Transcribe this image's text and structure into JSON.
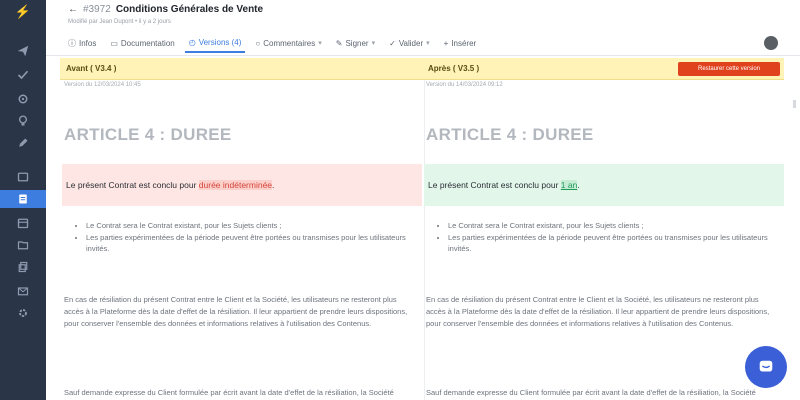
{
  "sidebar": {
    "logo": "⚡",
    "items": [
      {
        "icon": "send-icon"
      },
      {
        "icon": "check-icon"
      },
      {
        "icon": "settings-icon"
      },
      {
        "icon": "lightbulb-icon"
      },
      {
        "icon": "pen-icon"
      },
      {
        "icon": "inbox-icon"
      },
      {
        "icon": "document-icon",
        "active": true
      },
      {
        "icon": "calendar-icon"
      },
      {
        "icon": "folder-icon"
      },
      {
        "icon": "copy-icon"
      },
      {
        "icon": "mail-icon"
      },
      {
        "icon": "gear-icon"
      }
    ],
    "active_color": "#3d7de0"
  },
  "header": {
    "back": "←",
    "doc_id": "#3972",
    "doc_title": "Conditions Générales de Vente",
    "subtitle": "Modifié par Jean Dupont • il y a 2 jours",
    "tabs": [
      {
        "label": "Infos",
        "icon": "info-icon"
      },
      {
        "label": "Documentation",
        "icon": "book-icon"
      },
      {
        "label": "Versions (4)",
        "icon": "history-icon",
        "active": true
      },
      {
        "label": "Commentaires",
        "icon": "comment-icon",
        "chevron": true
      },
      {
        "label": "Signer",
        "icon": "pen-icon",
        "chevron": true
      },
      {
        "label": "Valider",
        "icon": "check-icon",
        "chevron": true
      },
      {
        "label": "Insérer",
        "icon": "plus-icon"
      }
    ]
  },
  "compare": {
    "left_label": "Avant ( V3.4 )",
    "right_label": "Après ( V3.5 )",
    "action_button": "Restaurer cette version",
    "left_meta": "Version du 12/03/2024 10:45",
    "right_meta": "Version du 14/03/2024 09:12",
    "bar_color": "#fff3b8",
    "button_color": "#e0421e"
  },
  "left": {
    "article_title": "ARTICLE 4 : DUREE",
    "diff_prefix": "Le présent Contrat est conclu pour ",
    "diff_changed": "durée indéterminée",
    "diff_suffix": ".",
    "bullets": [
      "Le Contrat sera le Contrat existant, pour les Sujets clients ;",
      "Les parties expérimentées de la période peuvent être portées ou transmises pour les utilisateurs invités."
    ],
    "paragraph1": "En cas de résiliation du présent Contrat entre le Client et la Société, les utilisateurs ne resteront plus accès à la Plateforme dès la date d'effet de la résiliation. Il leur appartient de prendre leurs dispositions, pour conserver l'ensemble des données et informations relatives à l'utilisation des Contenus.",
    "paragraph2": "Sauf demande expresse du Client formulée par écrit avant la date d'effet de la résiliation, la Société pourra supprimer ces données à l'issue de cette période."
  },
  "right": {
    "article_title": "ARTICLE 4 : DUREE",
    "diff_prefix": "Le présent Contrat est conclu pour ",
    "diff_changed": "1 an",
    "diff_suffix": ".",
    "bullets": [
      "Le Contrat sera le Contrat existant, pour les Sujets clients ;",
      "Les parties expérimentées de la période peuvent être portées ou transmises pour les utilisateurs invités."
    ],
    "paragraph1": "En cas de résiliation du présent Contrat entre le Client et la Société, les utilisateurs ne resteront plus accès à la Plateforme dès la date d'effet de la résiliation. Il leur appartient de prendre leurs dispositions, pour conserver l'ensemble des données et informations relatives à l'utilisation des Contenus.",
    "paragraph2": "Sauf demande expresse du Client formulée par écrit avant la date d'effet de la résiliation, la Société pourra supprimer ces données à l'issue de cette période."
  },
  "chat": {
    "icon": "chat-bubble-icon",
    "color": "#3b5fd6"
  }
}
